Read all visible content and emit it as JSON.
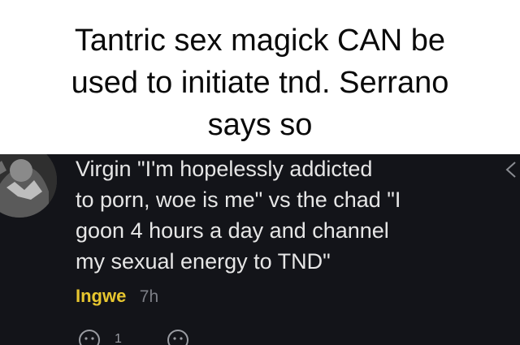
{
  "caption": {
    "lines": [
      "Tantric sex magick CAN be",
      "used to initiate tnd. Serrano",
      "says so"
    ]
  },
  "comment": {
    "lines": [
      "Virgin \"I'm hopelessly addicted",
      "to porn, woe is me\" vs the chad \"I",
      "goon 4 hours a day and channel",
      "my sexual energy to TND\""
    ],
    "author": "Ingwe",
    "timestamp": "7h",
    "reaction_count": "1"
  },
  "icons": {
    "avatar": "avatar-image",
    "reaction": "smiley-face-icon",
    "add_reaction": "add-reaction-icon",
    "collapse": "chevron-left-icon"
  },
  "colors": {
    "caption_bg": "#ffffff",
    "caption_text": "#0a0a0a",
    "panel_bg": "#131419",
    "comment_text": "#e6e6e6",
    "author": "#e7c62f",
    "timestamp": "#7d7f86"
  }
}
